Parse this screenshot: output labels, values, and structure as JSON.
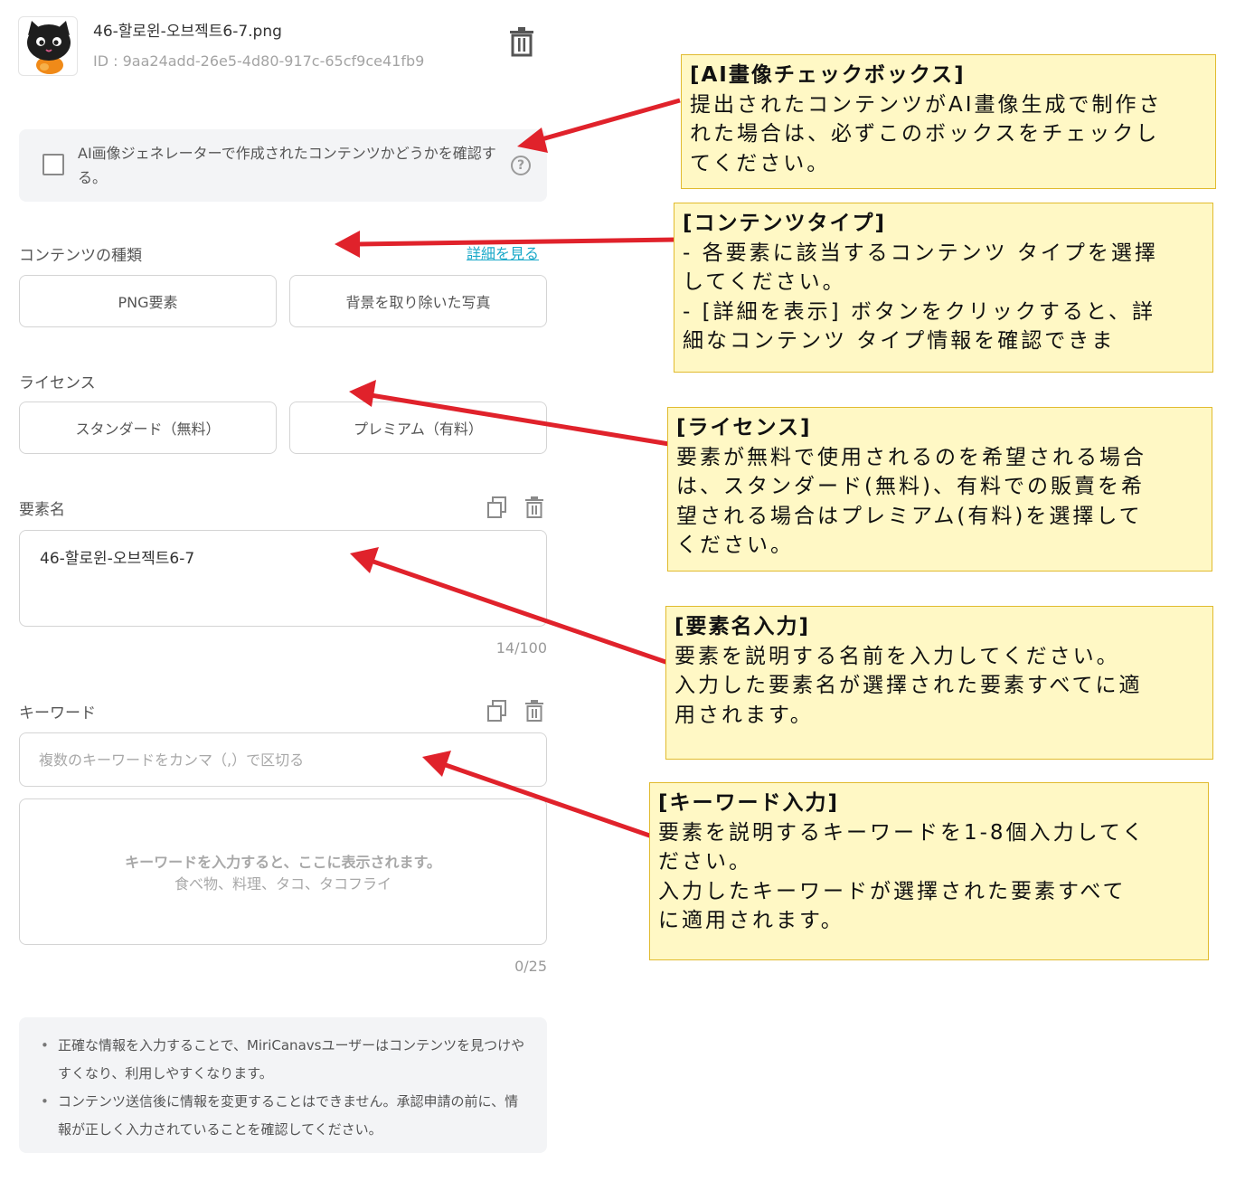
{
  "file": {
    "name": "46-할로윈-오브젝트6-7.png",
    "id": "ID : 9aa24add-26e5-4d80-917c-65cf9ce41fb9"
  },
  "ai_check": {
    "label": "AI画像ジェネレーターで作成されたコンテンツかどうかを確認する。",
    "help": "?"
  },
  "content_type": {
    "label": "コンテンツの種類",
    "detail_link": "詳細を見る",
    "options": [
      "PNG要素",
      "背景を取り除いた写真"
    ]
  },
  "license": {
    "label": "ライセンス",
    "options": [
      "スタンダード（無料）",
      "プレミアム（有料）"
    ]
  },
  "element_name": {
    "label": "要素名",
    "value": "46-할로윈-오브젝트6-7",
    "counter": "14/100"
  },
  "keywords": {
    "label": "キーワード",
    "placeholder": "複数のキーワードをカンマ（,）で区切る",
    "hint_title": "キーワードを入力すると、ここに表示されます。",
    "hint_example": "食べ物、料理、タコ、タコフライ",
    "counter": "0/25"
  },
  "notes": [
    "正確な情報を入力することで、MiriCanavsユーザーはコンテンツを見つけやすくなり、利用しやすくなります。",
    "コンテンツ送信後に情報を変更することはできません。承認申請の前に、情報が正しく入力されていることを確認してください。"
  ],
  "callouts": {
    "ai": {
      "title": "[AI畫像チェックボックス]",
      "lines": [
        "提出されたコンテンツがAI畫像生成で制作さ",
        "れた場合は、必ずこのボックスをチェックし",
        "てください。"
      ]
    },
    "content_type": {
      "title": "[コンテンツタイプ]",
      "lines": [
        "- 各要素に該当するコンテンツ タイプを選擇",
        "してください。",
        "- [詳細を表示] ボタンをクリックすると、詳",
        "細なコンテンツ タイプ情報を確認できま"
      ]
    },
    "license": {
      "title": "[ライセンス]",
      "lines": [
        "要素が無料で使用されるのを希望される場合",
        "は、スタンダード(無料)、有料での販賣を希",
        "望される場合はプレミアム(有料)を選擇して",
        "ください。"
      ]
    },
    "element_name": {
      "title": "[要素名入力]",
      "lines": [
        "要素を説明する名前を入力してください。",
        "入力した要素名が選擇された要素すべてに適",
        "用されます。"
      ]
    },
    "keywords": {
      "title": "[キーワード入力]",
      "lines": [
        "要素を説明するキーワードを1-8個入力してく",
        "ださい。",
        "入力したキーワードが選擇された要素すべて",
        "に適用されます。"
      ]
    }
  },
  "colors": {
    "callout_bg": "#fff8c5",
    "callout_border": "#e1bb2f",
    "arrow": "#e0222b",
    "link": "#1aa9c9",
    "panel_bg": "#f3f4f6"
  }
}
